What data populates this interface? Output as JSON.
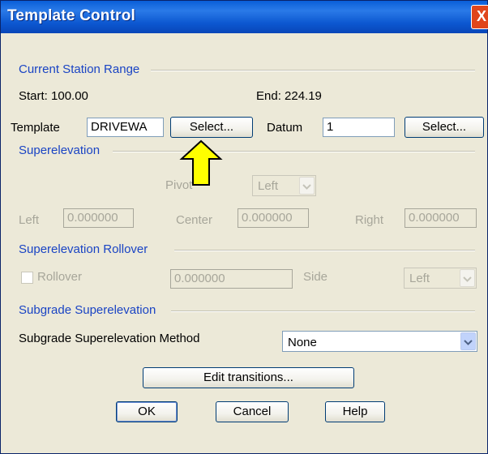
{
  "window": {
    "title": "Template Control",
    "close_label": "X"
  },
  "current_station_range": {
    "heading": "Current Station Range",
    "start": "Start: 100.00",
    "end": "End: 224.19"
  },
  "template_row": {
    "template_label": "Template",
    "template_value": "DRIVEWA",
    "select_label": "Select...",
    "datum_label": "Datum",
    "datum_value": "1",
    "datum_select_label": "Select..."
  },
  "superelevation": {
    "heading": "Superelevation",
    "pivot_label": "Pivot",
    "pivot_value": "Left",
    "left_label": "Left",
    "left_value": "0.000000",
    "center_label": "Center",
    "center_value": "0.000000",
    "right_label": "Right",
    "right_value": "0.000000"
  },
  "rollover": {
    "heading": "Superelevation Rollover",
    "rollover_label": "Rollover",
    "rollover_checked": false,
    "rollover_value": "0.000000",
    "side_label": "Side",
    "side_value": "Left"
  },
  "subgrade": {
    "heading": "Subgrade Superelevation",
    "method_label": "Subgrade Superelevation Method",
    "method_value": "None"
  },
  "buttons": {
    "edit_transitions": "Edit transitions...",
    "ok": "OK",
    "cancel": "Cancel",
    "help": "Help"
  },
  "colors": {
    "title_bar": "#0a5fd8",
    "annotation_arrow": "#ffff00",
    "group_heading": "#1a44c4"
  },
  "icons": {
    "annotation": "arrow-up-icon",
    "combo": "chevron-down-icon"
  }
}
